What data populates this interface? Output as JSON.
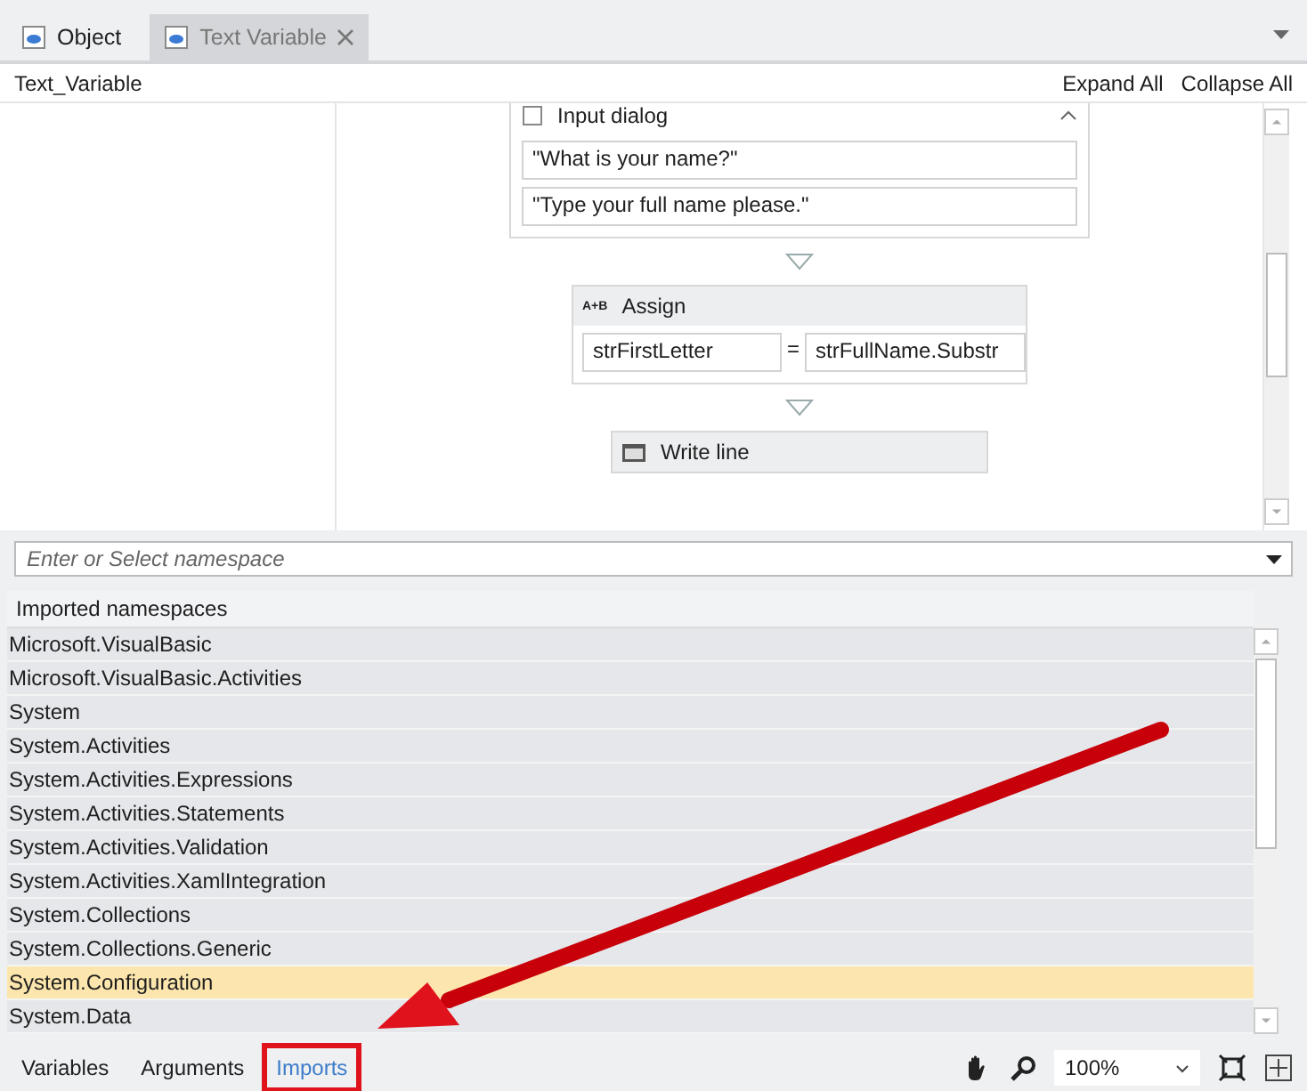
{
  "doc_tabs": [
    {
      "label": "Object",
      "selected": false,
      "closable": false
    },
    {
      "label": "Text Variable",
      "selected": true,
      "closable": true
    }
  ],
  "header": {
    "title": "Text_Variable",
    "actions": [
      "Expand All",
      "Collapse All"
    ]
  },
  "canvas": {
    "activities": [
      {
        "kind": "input",
        "title": "Input dialog",
        "fields": [
          "\"What is your name?\"",
          "\"Type your full name please.\""
        ]
      },
      {
        "kind": "assign",
        "title": "Assign",
        "badge": "A+B",
        "left": "strFirstLetter",
        "op": "=",
        "right": "strFullName.Substr"
      },
      {
        "kind": "writeline",
        "title": "Write line"
      }
    ]
  },
  "namespace_field": {
    "placeholder": "Enter or Select namespace"
  },
  "imports": {
    "heading": "Imported namespaces",
    "rows": [
      {
        "name": "Microsoft.VisualBasic",
        "selected": false
      },
      {
        "name": "Microsoft.VisualBasic.Activities",
        "selected": false
      },
      {
        "name": "System",
        "selected": false
      },
      {
        "name": "System.Activities",
        "selected": false
      },
      {
        "name": "System.Activities.Expressions",
        "selected": false
      },
      {
        "name": "System.Activities.Statements",
        "selected": false
      },
      {
        "name": "System.Activities.Validation",
        "selected": false
      },
      {
        "name": "System.Activities.XamlIntegration",
        "selected": false
      },
      {
        "name": "System.Collections",
        "selected": false
      },
      {
        "name": "System.Collections.Generic",
        "selected": false
      },
      {
        "name": "System.Configuration",
        "selected": true
      },
      {
        "name": "System.Data",
        "selected": false
      }
    ]
  },
  "bottom_tabs": [
    {
      "label": "Variables",
      "selected": false
    },
    {
      "label": "Arguments",
      "selected": false
    },
    {
      "label": "Imports",
      "selected": true
    }
  ],
  "zoom": {
    "value": "100%"
  }
}
